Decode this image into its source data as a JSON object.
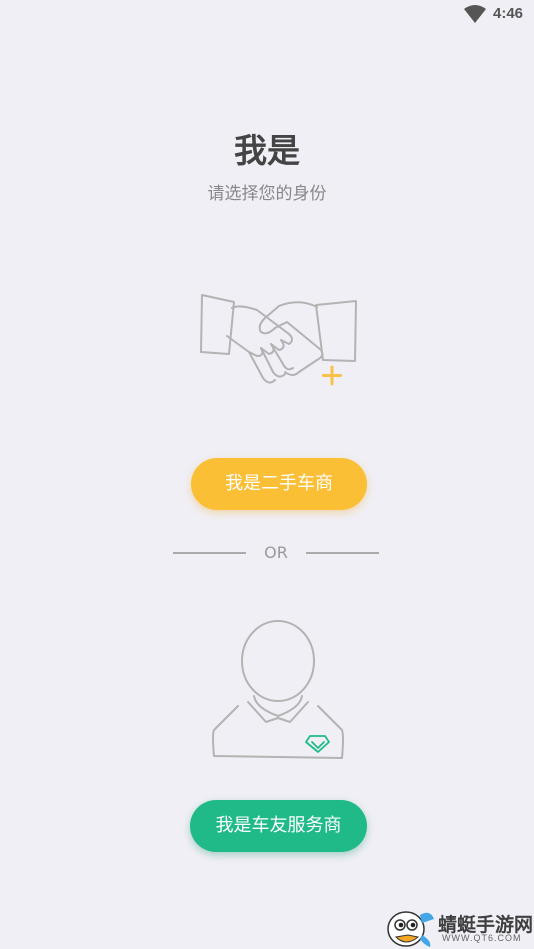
{
  "status_bar": {
    "time": "4:46",
    "wifi_icon": "wifi-icon"
  },
  "header": {
    "title": "我是",
    "subtitle": "请选择您的身份"
  },
  "dealer_option": {
    "icon": "handshake-plus-icon",
    "button_label": "我是二手车商",
    "button_color": "#fbbf36"
  },
  "divider": {
    "text": "OR"
  },
  "service_option": {
    "icon": "person-diamond-icon",
    "button_label": "我是车友服务商",
    "button_color": "#1fba88"
  },
  "watermark": {
    "text": "蜻蜓手游网",
    "url": "WWW.QT6.COM"
  }
}
